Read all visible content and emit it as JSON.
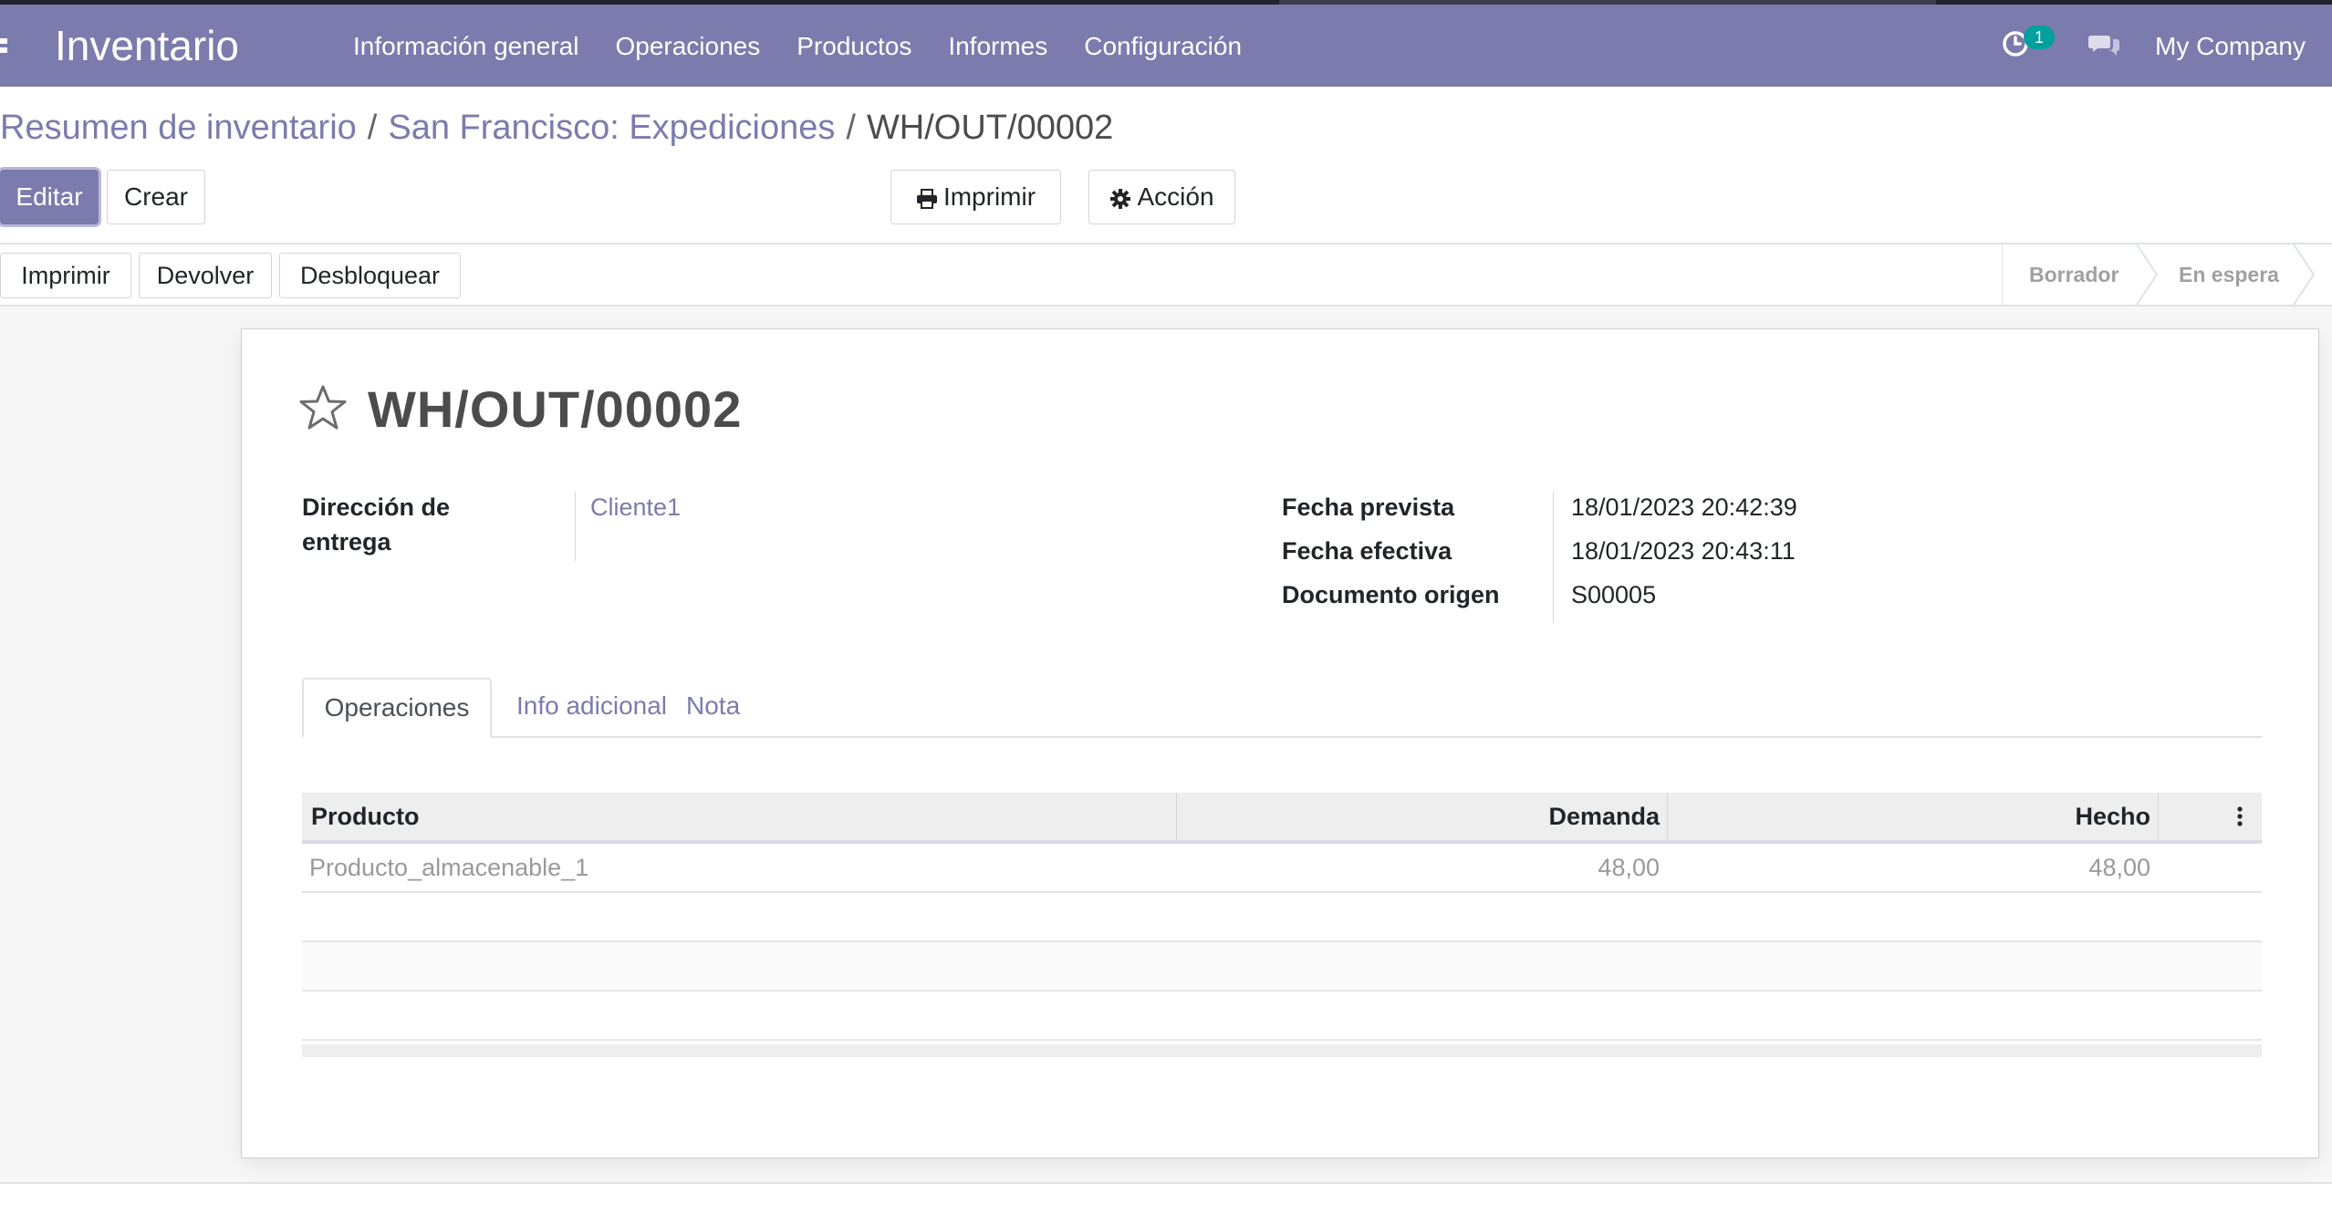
{
  "app": {
    "title": "Inventario",
    "menu": [
      "Información general",
      "Operaciones",
      "Productos",
      "Informes",
      "Configuración"
    ],
    "activity_count": "1",
    "company": "My Company"
  },
  "breadcrumb": {
    "items": [
      "Resumen de inventario",
      "San Francisco: Expediciones",
      "WH/OUT/00002"
    ],
    "separator": "/"
  },
  "control": {
    "edit": "Editar",
    "create": "Crear",
    "print": "Imprimir",
    "action": "Acción"
  },
  "statusbar": {
    "buttons": [
      "Imprimir",
      "Devolver",
      "Desbloquear"
    ],
    "stages": [
      "Borrador",
      "En espera"
    ]
  },
  "record": {
    "name": "WH/OUT/00002",
    "delivery_address_label": "Dirección de entrega",
    "delivery_address": "Cliente1",
    "fields": [
      {
        "label": "Fecha prevista",
        "value": "18/01/2023 20:42:39"
      },
      {
        "label": "Fecha efectiva",
        "value": "18/01/2023 20:43:11"
      },
      {
        "label": "Documento origen",
        "value": "S00005"
      }
    ]
  },
  "tabs": [
    "Operaciones",
    "Info adicional",
    "Nota"
  ],
  "table": {
    "columns": [
      "Producto",
      "Demanda",
      "Hecho"
    ],
    "rows": [
      {
        "product": "Producto_almacenable_1",
        "demand": "48,00",
        "done": "48,00"
      }
    ]
  },
  "colors": {
    "brand": "#7c7bad",
    "navbar_text": "#ffffff",
    "badge": "#00a09d"
  },
  "icons": [
    "apps-icon",
    "clock-icon",
    "chat-icon",
    "print-icon",
    "gear-icon",
    "star-icon",
    "column-options-icon"
  ]
}
